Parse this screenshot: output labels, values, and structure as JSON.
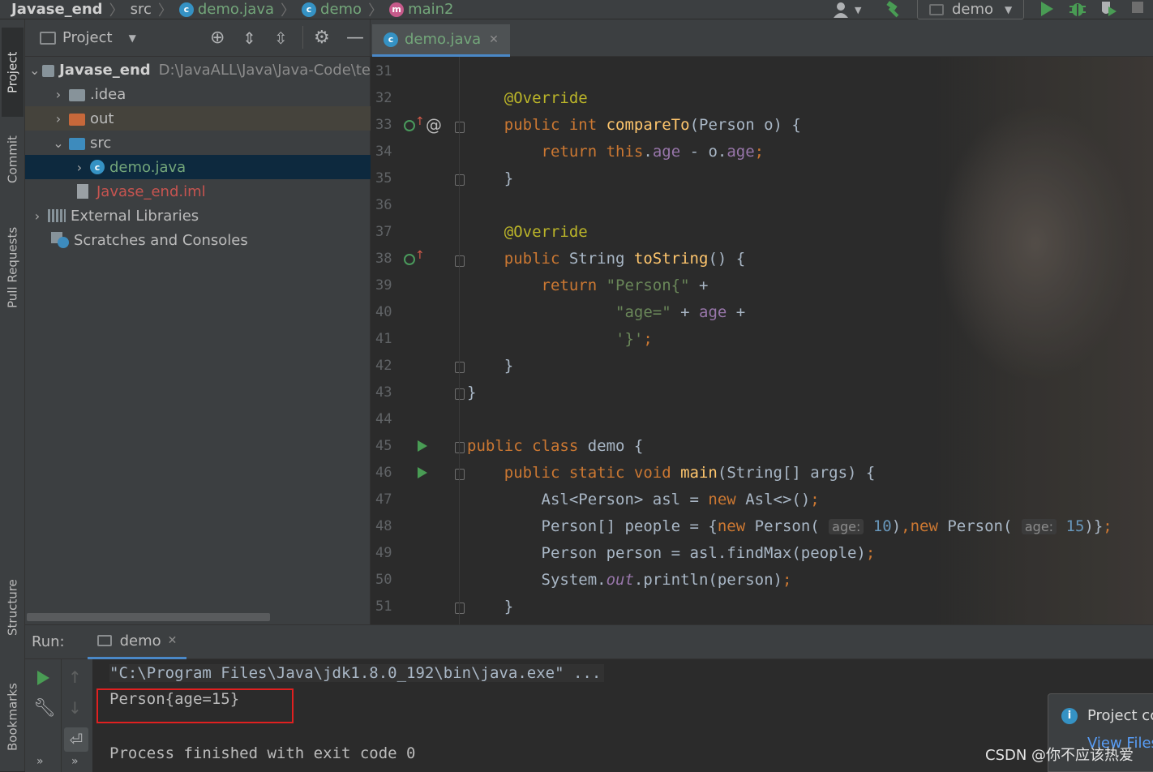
{
  "navbar": {
    "crumbs": [
      {
        "label": "Javase_end",
        "icon": "folder"
      },
      {
        "label": "src",
        "icon": "none"
      },
      {
        "label": "demo.java",
        "icon": "java-class-icon"
      },
      {
        "label": "demo",
        "icon": "java-class-icon"
      },
      {
        "label": "main2",
        "icon": "method-icon"
      }
    ],
    "run_config": "demo"
  },
  "left_strip": {
    "tabs": [
      "Project",
      "Commit",
      "Pull Requests",
      "Structure",
      "Bookmarks"
    ]
  },
  "project_panel": {
    "title": "Project",
    "items": [
      {
        "label": "Javase_end",
        "path": "D:\\JavaALL\\Java\\Java-Code\\te",
        "depth": 0,
        "expanded": true,
        "icon": "module-folder"
      },
      {
        "label": ".idea",
        "depth": 1,
        "expanded": false,
        "icon": "folder"
      },
      {
        "label": "out",
        "depth": 1,
        "expanded": false,
        "icon": "folder-excluded"
      },
      {
        "label": "src",
        "depth": 1,
        "expanded": true,
        "icon": "folder-source"
      },
      {
        "label": "demo.java",
        "depth": 2,
        "expanded": false,
        "icon": "java-class-icon",
        "selected": true
      },
      {
        "label": "Javase_end.iml",
        "depth": 1,
        "icon": "iml-file-icon"
      },
      {
        "label": "External Libraries",
        "depth": 0,
        "expanded": false,
        "icon": "libraries-icon"
      },
      {
        "label": "Scratches and Consoles",
        "depth": 0,
        "icon": "scratches-icon"
      }
    ]
  },
  "editor": {
    "tab_label": "demo.java",
    "line_numbers": [
      "31",
      "32",
      "33",
      "34",
      "35",
      "36",
      "37",
      "38",
      "39",
      "40",
      "41",
      "42",
      "43",
      "44",
      "45",
      "46",
      "47",
      "48",
      "49",
      "50",
      "51"
    ],
    "hints": {
      "age1": "age:",
      "age2": "age:"
    }
  },
  "run_panel": {
    "label": "Run:",
    "tab": "demo",
    "console_lines": [
      "\"C:\\Program Files\\Java\\jdk1.8.0_192\\bin\\java.exe\" ...",
      "Person{age=15}",
      "",
      "Process finished with exit code 0"
    ],
    "notification_title": "Project cc",
    "notification_link": "View Files"
  },
  "watermark": "CSDN @你不应该热爱",
  "colors": {
    "accent": "#4a88c7",
    "run_green": "#499c54",
    "highlight_box": "#e02020"
  }
}
